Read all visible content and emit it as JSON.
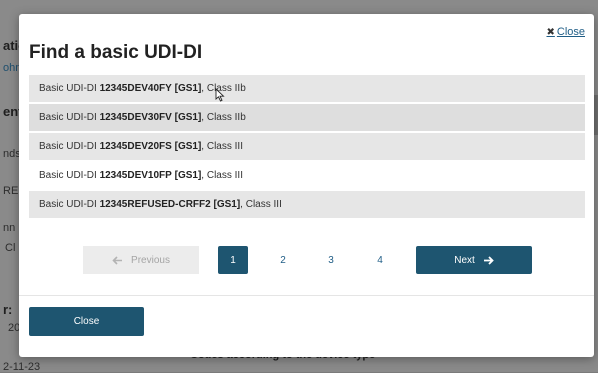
{
  "background": {
    "fragments": [
      "atic",
      "ohn",
      "ent",
      "nds",
      "RE",
      "nn",
      "Cl",
      "r:",
      "20",
      "2-11-23"
    ],
    "section_heading": "Codes according to the device type"
  },
  "modal": {
    "close_label": "Close",
    "title": "Find a basic UDI-DI",
    "rows": [
      {
        "prefix": "Basic UDI-DI ",
        "code": "12345DEV40FY",
        "agency": "[GS1]",
        "suffix": ", Class IIb"
      },
      {
        "prefix": "Basic UDI-DI ",
        "code": "12345DEV30FV",
        "agency": "[GS1]",
        "suffix": ", Class IIb"
      },
      {
        "prefix": "Basic UDI-DI ",
        "code": "12345DEV20FS",
        "agency": "[GS1]",
        "suffix": ", Class III"
      },
      {
        "prefix": "Basic UDI-DI ",
        "code": "12345DEV10FP",
        "agency": "[GS1]",
        "suffix": ", Class III"
      },
      {
        "prefix": "Basic UDI-DI ",
        "code": "12345REFUSED-CRFF2",
        "agency": "[GS1]",
        "suffix": ", Class III"
      }
    ],
    "pagination": {
      "previous_label": "Previous",
      "next_label": "Next",
      "pages": [
        "1",
        "2",
        "3",
        "4"
      ],
      "current_page": "1"
    },
    "footer_close_label": "Close"
  },
  "colors": {
    "primary": "#1e5570",
    "link": "#1f5d86",
    "row_shade": "#e6e6e6",
    "overlay": "#8a8a8a"
  },
  "icons": {
    "close": "close-x-icon",
    "previous": "arrow-left-icon",
    "next": "arrow-right-icon",
    "cursor": "mouse-pointer-icon"
  }
}
